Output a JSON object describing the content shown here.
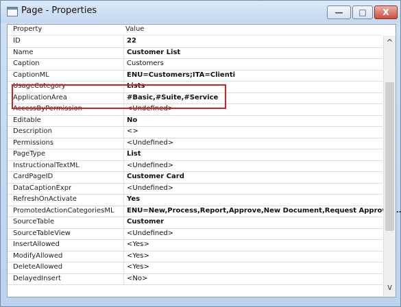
{
  "window": {
    "title": "Page - Properties",
    "minimize_glyph": "—",
    "maximize_glyph": "□",
    "close_glyph": "X"
  },
  "table": {
    "headers": {
      "property": "Property",
      "value": "Value"
    },
    "rows": [
      {
        "property": "ID",
        "value": "22",
        "bold": true
      },
      {
        "property": "Name",
        "value": "Customer List",
        "bold": true
      },
      {
        "property": "Caption",
        "value": "Customers",
        "bold": false
      },
      {
        "property": "CaptionML",
        "value": "ENU=Customers;ITA=Clienti",
        "bold": true
      },
      {
        "property": "UsageCategory",
        "value": "Lists",
        "bold": true
      },
      {
        "property": "ApplicationArea",
        "value": "#Basic,#Suite,#Service",
        "bold": true
      },
      {
        "property": "AccessByPermission",
        "value": "<Undefined>",
        "bold": false
      },
      {
        "property": "Editable",
        "value": "No",
        "bold": true
      },
      {
        "property": "Description",
        "value": "<>",
        "bold": false
      },
      {
        "property": "Permissions",
        "value": "<Undefined>",
        "bold": false
      },
      {
        "property": "PageType",
        "value": "List",
        "bold": true
      },
      {
        "property": "InstructionalTextML",
        "value": "<Undefined>",
        "bold": false
      },
      {
        "property": "CardPageID",
        "value": "Customer Card",
        "bold": true
      },
      {
        "property": "DataCaptionExpr",
        "value": "<Undefined>",
        "bold": false
      },
      {
        "property": "RefreshOnActivate",
        "value": "Yes",
        "bold": true
      },
      {
        "property": "PromotedActionCategoriesML",
        "value": "ENU=New,Process,Report,Approve,New Document,Request Approval,...",
        "bold": true
      },
      {
        "property": "SourceTable",
        "value": "Customer",
        "bold": true
      },
      {
        "property": "SourceTableView",
        "value": "<Undefined>",
        "bold": false
      },
      {
        "property": "InsertAllowed",
        "value": "<Yes>",
        "bold": false
      },
      {
        "property": "ModifyAllowed",
        "value": "<Yes>",
        "bold": false
      },
      {
        "property": "DeleteAllowed",
        "value": "<Yes>",
        "bold": false
      },
      {
        "property": "DelayedInsert",
        "value": "<No>",
        "bold": false
      }
    ]
  },
  "highlight": {
    "color": "#d02020"
  },
  "scrollbar": {
    "up_arrow": "^",
    "down_arrow": "v"
  }
}
